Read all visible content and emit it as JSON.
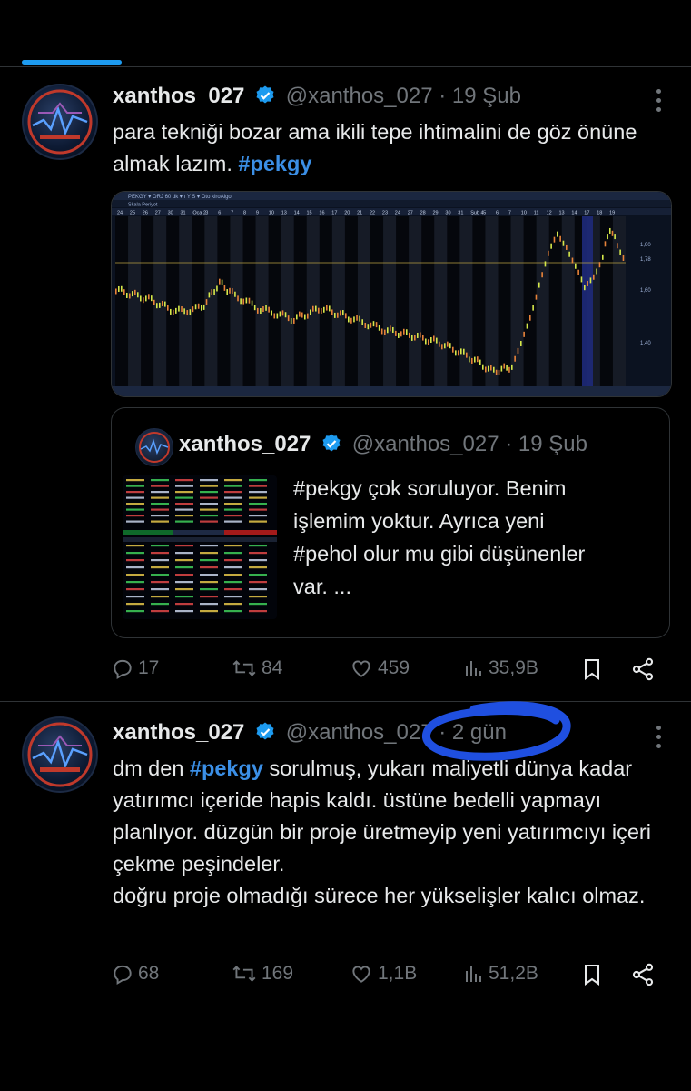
{
  "colors": {
    "accent": "#1d9bf0",
    "hashtag": "#3b8fe6",
    "muted": "#71767b",
    "text": "#e7e9ea",
    "annotation": "#1f4fe0"
  },
  "tweets": [
    {
      "name": "xanthos_027",
      "handle": "@xanthos_027",
      "time": "· 19 Şub",
      "text_before": "para tekniği bozar ama ikili tepe ihtimalini de göz önüne almak lazım. ",
      "hashtag": "#pekgy",
      "chart": {
        "toolbar": "PEKGY  ▾  ORJ  60 dk  ▾  ı  Y  S  ▾  Oto  kiroAlgo",
        "subbar": "Skala  Periyot",
        "date_labels": [
          "24",
          "25",
          "26",
          "27",
          "30",
          "31",
          "Oca 2",
          "3",
          "6",
          "7",
          "8",
          "9",
          "10",
          "13",
          "14",
          "15",
          "16",
          "17",
          "20",
          "21",
          "22",
          "23",
          "24",
          "27",
          "28",
          "29",
          "30",
          "31",
          "Şub 4",
          "5",
          "6",
          "7",
          "10",
          "11",
          "12",
          "13",
          "14",
          "17",
          "18",
          "19"
        ],
        "price_labels": [
          "1,90",
          "1,78",
          "1,60",
          "1,40"
        ]
      },
      "quote": {
        "name": "xanthos_027",
        "handle": "@xanthos_027",
        "time": "· 19 Şub",
        "line1": "#pekgy çok soruluyor. Benim",
        "line2": "işlemim yoktur. Ayrıca yeni",
        "line3": "#pehol olur mu gibi düşünenler",
        "line4": "var. ..."
      },
      "actions": {
        "replies": "17",
        "reposts": "84",
        "likes": "459",
        "views": "35,9B"
      }
    },
    {
      "name": "xanthos_027",
      "handle": "@xanthos_027",
      "time": "· 2 gün",
      "text_pre": "dm den ",
      "hashtag": "#pekgy",
      "text_post": " sorulmuş, yukarı maliyetli dünya kadar yatırımcı içeride hapis kaldı. üstüne bedelli yapmayı planlıyor. düzgün bir proje üretmeyip yeni yatırımcıyı içeri çekme peşindeler.",
      "text_line2": "doğru proje olmadığı sürece her yükselişler kalıcı olmaz.",
      "actions": {
        "replies": "68",
        "reposts": "169",
        "likes": "1,1B",
        "views": "51,2B"
      }
    }
  ]
}
